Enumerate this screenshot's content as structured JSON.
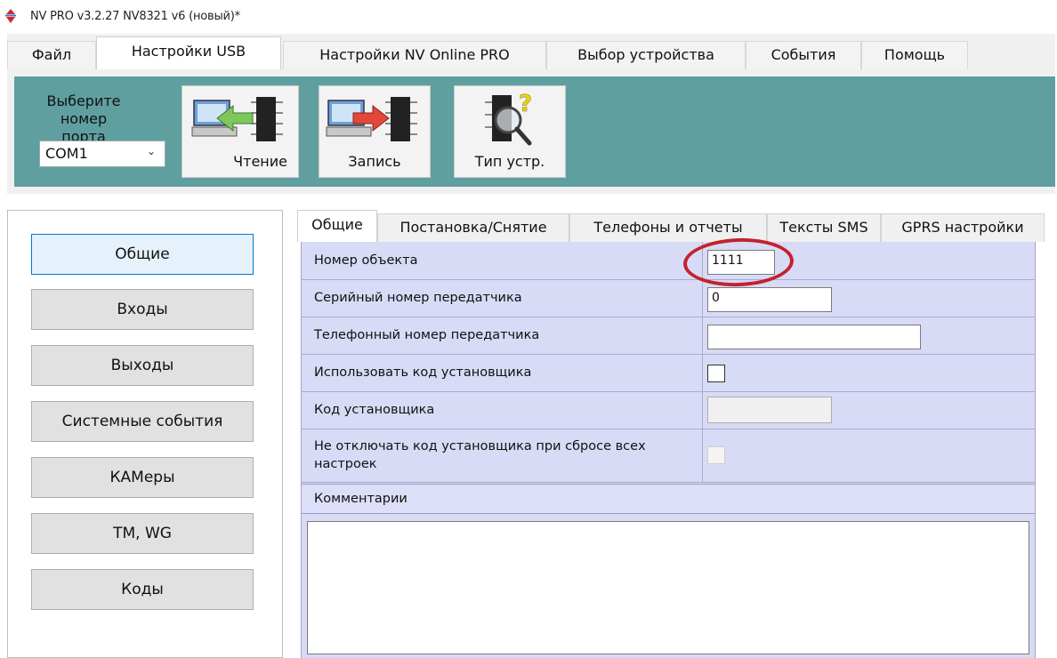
{
  "window": {
    "title": "NV PRO v3.2.27 NV8321 v6 (новый)*"
  },
  "menu": {
    "tabs": [
      {
        "label": "Файл"
      },
      {
        "label": "Настройки USB",
        "active": true
      },
      {
        "label": "Настройки NV Online PRO"
      },
      {
        "label": "Выбор устройства"
      },
      {
        "label": "События"
      },
      {
        "label": "Помощь"
      }
    ]
  },
  "toolbar": {
    "port_label": "Выберите номер порта",
    "port_value": "COM1",
    "read_label": "Чтение",
    "write_label": "Запись",
    "device_type_label": "Тип устр.",
    "accent_color": "#5f9fa0"
  },
  "sidebar": {
    "items": [
      {
        "label": "Общие",
        "active": true
      },
      {
        "label": "Входы"
      },
      {
        "label": "Выходы"
      },
      {
        "label": "Системные события"
      },
      {
        "label": "КАМеры"
      },
      {
        "label": "TM, WG"
      },
      {
        "label": "Коды"
      }
    ]
  },
  "tabs": {
    "items": [
      {
        "label": "Общие",
        "active": true
      },
      {
        "label": "Постановка/Снятие"
      },
      {
        "label": "Телефоны и отчеты"
      },
      {
        "label": "Тексты SMS"
      },
      {
        "label": "GPRS настройки"
      }
    ]
  },
  "form": {
    "object_number": {
      "label": "Номер объекта",
      "value": "1111"
    },
    "serial_number": {
      "label": "Серийный номер передатчика",
      "value": "0"
    },
    "phone_number": {
      "label": "Телефонный номер передатчика",
      "value": ""
    },
    "use_installer_code": {
      "label": "Использовать код установщика",
      "checked": false
    },
    "installer_code": {
      "label": "Код установщика",
      "value": ""
    },
    "keep_installer_code": {
      "label": "Не отключать код установщика при сбросе всех настроек",
      "checked": false
    },
    "comments": {
      "label": "Комментарии",
      "value": ""
    }
  },
  "colors": {
    "panel_bg": "#d8dbf5",
    "highlight": "#c4222c",
    "active_border": "#0078d7"
  }
}
